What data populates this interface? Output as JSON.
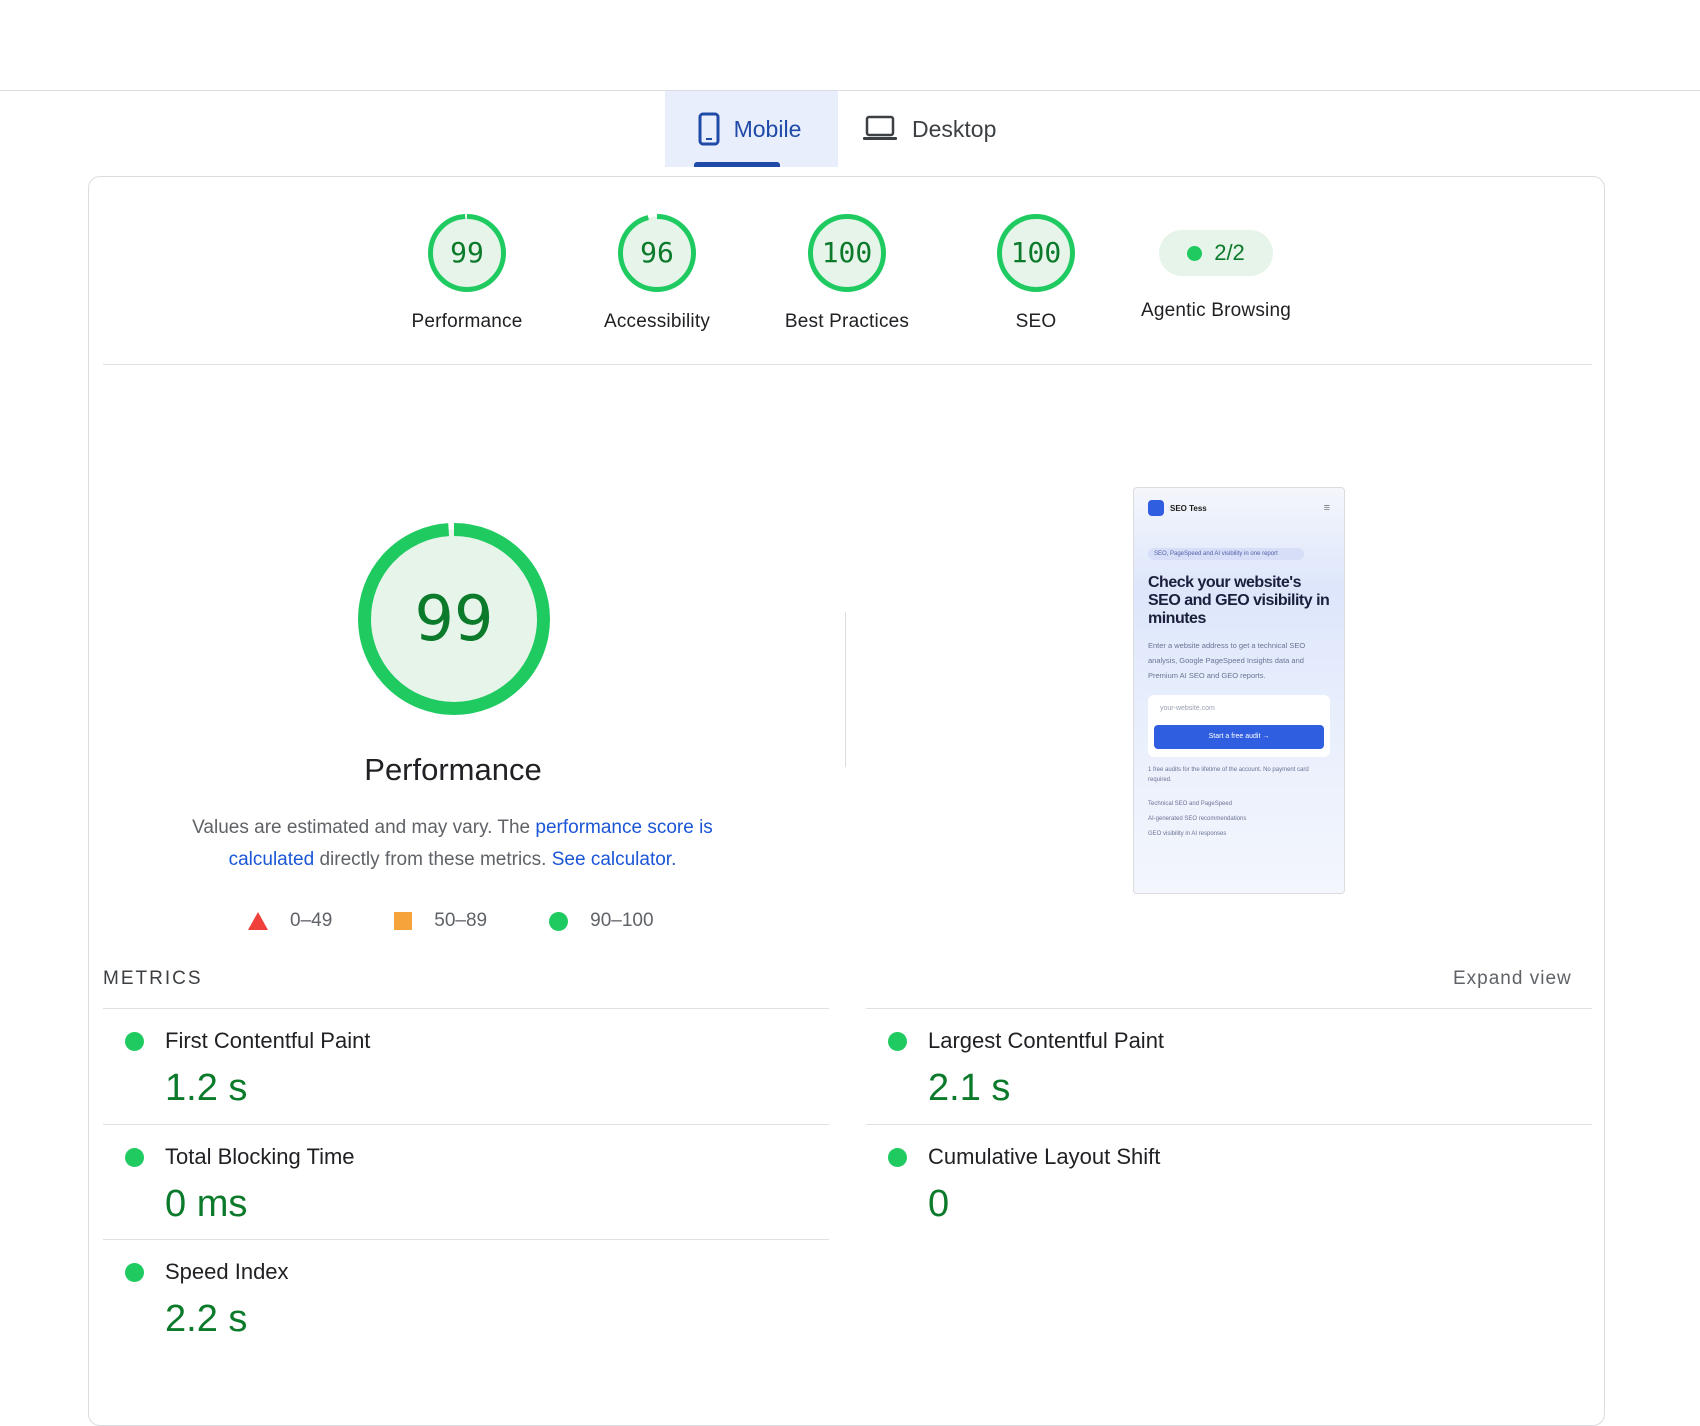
{
  "tabs": [
    {
      "label": "Mobile",
      "icon": "phone-icon",
      "active": true
    },
    {
      "label": "Desktop",
      "icon": "laptop-icon",
      "active": false
    }
  ],
  "categories": [
    {
      "label": "Performance",
      "score": "99",
      "fraction": 0.99
    },
    {
      "label": "Accessibility",
      "score": "96",
      "fraction": 0.96
    },
    {
      "label": "Best Practices",
      "score": "100",
      "fraction": 1.0
    },
    {
      "label": "SEO",
      "score": "100",
      "fraction": 1.0
    },
    {
      "label": "Agentic Browsing",
      "score": "2/2"
    }
  ],
  "performance": {
    "score": "99",
    "fraction": 0.99,
    "title": "Performance",
    "desc_1": "Values are estimated and may vary. The ",
    "link_1": "performance score is calculated",
    "desc_2": " directly from these metrics. ",
    "link_2": "See calculator."
  },
  "legend": [
    {
      "range": "0–49",
      "shape": "triangle",
      "color": "#f0403a"
    },
    {
      "range": "50–89",
      "shape": "square",
      "color": "#f7a33b"
    },
    {
      "range": "90–100",
      "shape": "circle",
      "color": "#1fcb61"
    }
  ],
  "screenshot": {
    "brand": "SEO Tess",
    "pill": "SEO, PageSpeed and AI visibility in one report",
    "heading": "Check your website's SEO and GEO visibility in minutes",
    "sub": "Enter a website address to get a technical SEO analysis, Google PageSpeed Insights data and Premium AI SEO and GEO reports.",
    "input_placeholder": "your-website.com",
    "cta": "Start a free audit →",
    "fine": "1 free audits for the lifetime of the account. No payment card required.",
    "checks": [
      "Technical SEO and PageSpeed",
      "AI-generated SEO recommendations",
      "GEO visibility in AI responses"
    ]
  },
  "metrics_header": "METRICS",
  "expand_label": "Expand view",
  "metrics": [
    {
      "name": "First Contentful Paint",
      "value": "1.2 s"
    },
    {
      "name": "Largest Contentful Paint",
      "value": "2.1 s"
    },
    {
      "name": "Total Blocking Time",
      "value": "0 ms"
    },
    {
      "name": "Cumulative Layout Shift",
      "value": "0"
    },
    {
      "name": "Speed Index",
      "value": "2.2 s"
    }
  ],
  "colors": {
    "pass": "#1fcb61",
    "pass_text": "#0c7a2b",
    "pass_bg": "#e6f4ea",
    "link": "#1a56d6",
    "accent": "#1f4aa8"
  }
}
